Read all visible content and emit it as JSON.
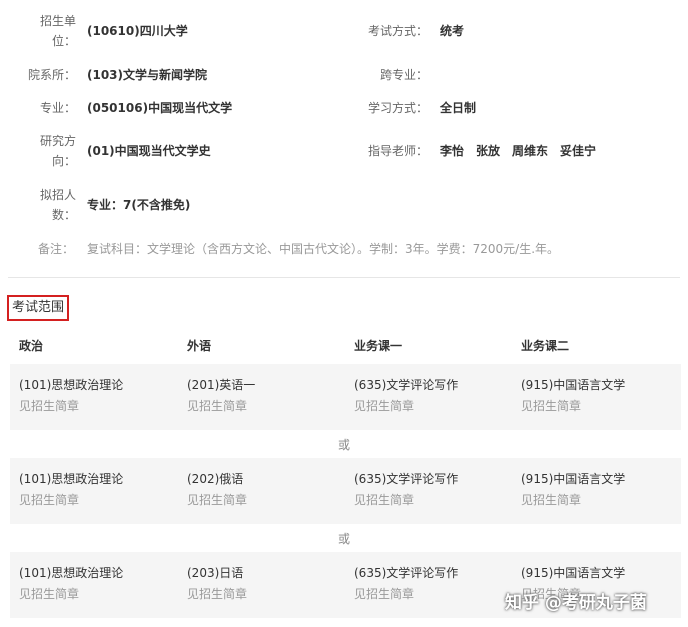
{
  "info": {
    "school_label_1": "招生单",
    "school_label_2": "位：",
    "school_value": "(10610)四川大学",
    "exam_method_label": "考试方式：",
    "exam_method_value": "统考",
    "dept_label": "院系所：",
    "dept_value": "(103)文学与新闻学院",
    "cross_major_label": "跨专业：",
    "major_label": "专业：",
    "major_value": "(050106)中国现当代文学",
    "study_mode_label": "学习方式：",
    "study_mode_value": "全日制",
    "direction_label_1": "研究方",
    "direction_label_2": "向：",
    "direction_value": "(01)中国现当代文学史",
    "advisor_label": "指导老师：",
    "advisors": [
      "李怡",
      "张放",
      "周维东",
      "妥佳宁"
    ],
    "quota_label_1": "拟招人",
    "quota_label_2": "数：",
    "quota_value": "专业：7(不含推免)",
    "remark_label": "备注：",
    "remark_value": "复试科目：文学理论（含西方文论、中国古代文论）。学制：3年。学费：7200元/生.年。"
  },
  "scope": {
    "title": "考试范围",
    "headers": [
      "政治",
      "外语",
      "业务课一",
      "业务课二"
    ],
    "or_label": "或",
    "groups": [
      {
        "cells": [
          {
            "subject": "(101)思想政治理论",
            "note": "见招生简章"
          },
          {
            "subject": "(201)英语一",
            "note": "见招生简章"
          },
          {
            "subject": "(635)文学评论写作",
            "note": "见招生简章"
          },
          {
            "subject": "(915)中国语言文学",
            "note": "见招生简章"
          }
        ]
      },
      {
        "cells": [
          {
            "subject": "(101)思想政治理论",
            "note": "见招生简章"
          },
          {
            "subject": "(202)俄语",
            "note": "见招生简章"
          },
          {
            "subject": "(635)文学评论写作",
            "note": "见招生简章"
          },
          {
            "subject": "(915)中国语言文学",
            "note": "见招生简章"
          }
        ]
      },
      {
        "cells": [
          {
            "subject": "(101)思想政治理论",
            "note": "见招生简章"
          },
          {
            "subject": "(203)日语",
            "note": "见招生简章"
          },
          {
            "subject": "(635)文学评论写作",
            "note": "见招生简章"
          },
          {
            "subject": "(915)中国语言文学",
            "note": "见招生简章"
          }
        ]
      }
    ]
  },
  "watermark": "知乎 @考研丸子菌"
}
